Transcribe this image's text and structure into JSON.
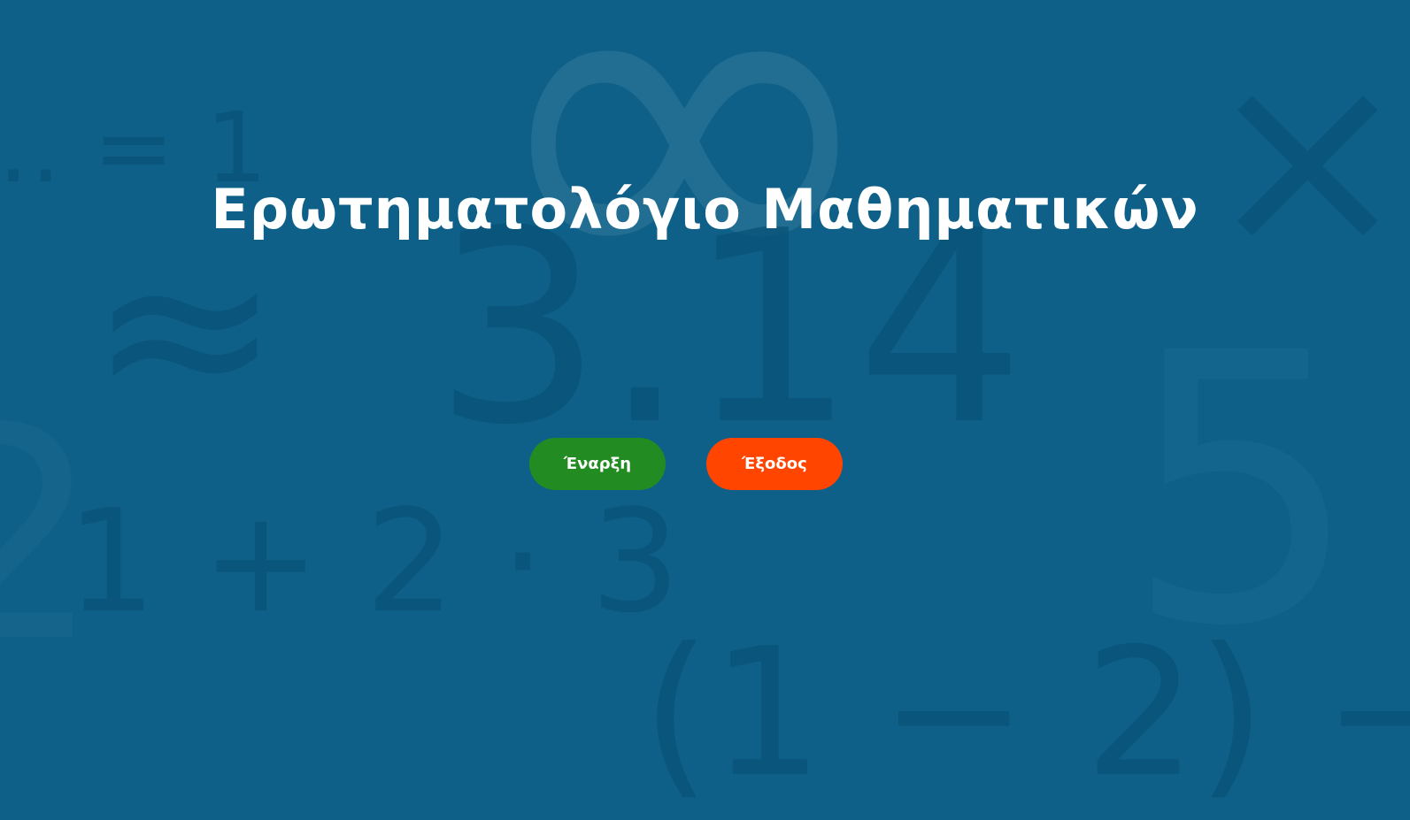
{
  "title": "Ερωτηματολόγιο Μαθηματικών",
  "buttons": {
    "start_label": "Έναρξη",
    "exit_label": "Έξοδος"
  },
  "background": {
    "symbols": {
      "infinity": "∞",
      "times": "×",
      "approx": "≈",
      "pi_value": "3.14",
      "five": "5",
      "equals_one": "… = 1",
      "expression": "1 + 2 · 3",
      "paren_expression": "(1 − 2) −",
      "partial_two": "2",
      "minus": "−"
    }
  },
  "colors": {
    "background": "#0e6088",
    "start_button": "#228b22",
    "exit_button": "#ff4500",
    "title_text": "#ffffff"
  }
}
